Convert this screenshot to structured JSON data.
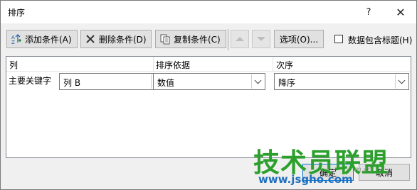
{
  "dialog": {
    "title": "排序",
    "help_symbol": "?",
    "close_symbol": "✕"
  },
  "toolbar": {
    "add_label": "添加条件(A)",
    "delete_label": "删除条件(D)",
    "copy_label": "复制条件(C)",
    "options_label": "选项(O)...",
    "header_checkbox_label": "数据包含标题(H)",
    "header_checkbox_checked": false
  },
  "grid": {
    "headers": [
      "列",
      "排序依据",
      "次序"
    ],
    "rows": [
      {
        "label": "主要关键字",
        "column": "列 B",
        "sort_on": "数值",
        "order": "降序"
      }
    ]
  },
  "footer": {
    "ok_label": "确定",
    "cancel_label": "取消"
  },
  "watermark": {
    "text": "技术员联盟",
    "url": "www.jsgho.com",
    "small": "m.cn"
  }
}
